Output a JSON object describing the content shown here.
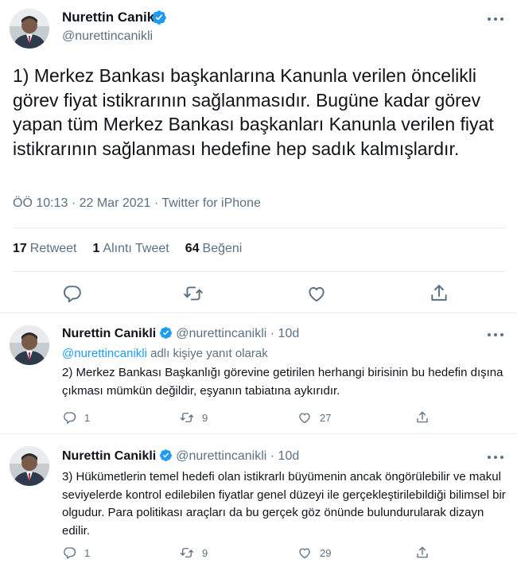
{
  "main_tweet": {
    "author_name": "Nurettin Canikli",
    "author_handle": "@nurettincanikli",
    "text": "1) Merkez Bankası başkanlarına Kanunla verilen öncelikli görev fiyat istikrarının sağlanmasıdır. Bugüne kadar görev yapan tüm Merkez Bankası başkanları Kanunla verilen fiyat istikrarının sağlanması hedefine hep sadık kalmışlardır.",
    "meta": "ÖÖ 10:13 · 22 Mar 2021 · Twitter for iPhone",
    "stats": [
      {
        "count": "17",
        "label": "Retweet"
      },
      {
        "count": "1",
        "label": "Alıntı Tweet"
      },
      {
        "count": "64",
        "label": "Beğeni"
      }
    ],
    "actions": [
      "reply-icon",
      "retweet-icon",
      "like-icon",
      "share-icon"
    ]
  },
  "replies": [
    {
      "author_name": "Nurettin Canikli",
      "author_handle": "@nurettincanikli",
      "separator": "·",
      "time": "10d",
      "reply_to_handle": "@nurettincanikli",
      "reply_to_suffix": " adlı kişiye yanıt olarak",
      "text": "2) Merkez Bankası Başkanlığı görevine getirilen herhangi birisinin bu hedefin dışına çıkması mümkün değildir, eşyanın tabiatına aykırıdır.",
      "reply_count": "1",
      "retweet_count": "9",
      "like_count": "27"
    },
    {
      "author_name": "Nurettin Canikli",
      "author_handle": "@nurettincanikli",
      "separator": "·",
      "time": "10d",
      "text": "3) Hükümetlerin temel hedefi olan istikrarlı büyümenin ancak öngörülebilir ve makul seviyelerde kontrol edilebilen fiyatlar genel düzeyi ile gerçekleştirilebildiği bilimsel bir olgudur. Para politikası araçları da bu gerçek göz önünde bulundurularak dizayn edilir.",
      "reply_count": "1",
      "retweet_count": "9",
      "like_count": "29"
    }
  ],
  "colors": {
    "text_primary": "#0f1419",
    "text_secondary": "#5b7083",
    "link": "#1d9bf0",
    "verified": "#1d9bf0",
    "divider": "#e6ecf0"
  }
}
